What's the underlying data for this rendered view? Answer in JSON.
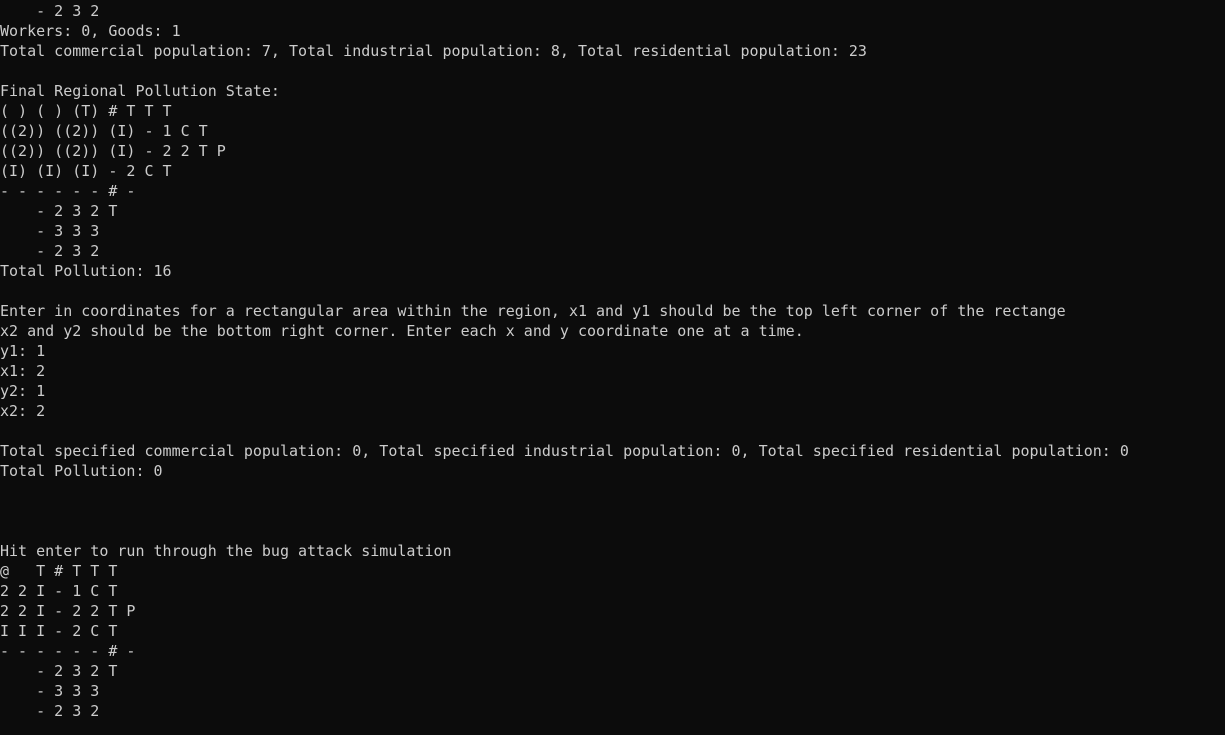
{
  "console": {
    "lines": [
      "    - 2 3 2",
      "Workers: 0, Goods: 1",
      "Total commercial population: 7, Total industrial population: 8, Total residential population: 23",
      "",
      "Final Regional Pollution State:",
      "( ) ( ) (T) # T T T",
      "((2)) ((2)) (I) - 1 C T",
      "((2)) ((2)) (I) - 2 2 T P",
      "(I) (I) (I) - 2 C T",
      "- - - - - - # -",
      "    - 2 3 2 T",
      "    - 3 3 3",
      "    - 2 3 2",
      "Total Pollution: 16",
      "",
      "Enter in coordinates for a rectangular area within the region, x1 and y1 should be the top left corner of the rectange",
      "x2 and y2 should be the bottom right corner. Enter each x and y coordinate one at a time.",
      "y1: 1",
      "x1: 2",
      "y2: 1",
      "x2: 2",
      "",
      "Total specified commercial population: 0, Total specified industrial population: 0, Total specified residential population: 0",
      "Total Pollution: 0",
      "",
      "",
      "",
      "Hit enter to run through the bug attack simulation",
      "@   T # T T T",
      "2 2 I - 1 C T",
      "2 2 I - 2 2 T P",
      "I I I - 2 C T",
      "- - - - - - # -",
      "    - 2 3 2 T",
      "    - 3 3 3",
      "    - 2 3 2"
    ]
  }
}
